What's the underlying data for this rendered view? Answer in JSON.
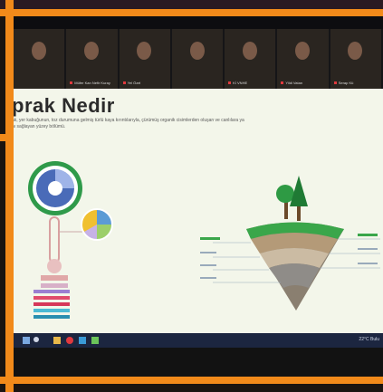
{
  "participants": [
    {
      "name": ""
    },
    {
      "name": "Müfer Kan Nefir Kuray"
    },
    {
      "name": "Yel Özel"
    },
    {
      "name": ""
    },
    {
      "name": "Kİ VNHE"
    },
    {
      "name": "Yildi Vatan"
    },
    {
      "name": "Serap Kü"
    }
  ],
  "slide": {
    "title": "prak Nedir",
    "subtitle": "ak, yer kabuğunun, toz durumuna gelmiş türlü kaya kırıntılarıyla, çürümüş organik cisimlerden oluşan ve canlılara ya\nnı sağlayan yüzey bölümü."
  },
  "taskbar": {
    "weather": "22°C Bulu"
  },
  "colors": {
    "frame": "#f28a1a",
    "slide_bg": "#f3f6ea",
    "taskbar": "#1c2640"
  }
}
